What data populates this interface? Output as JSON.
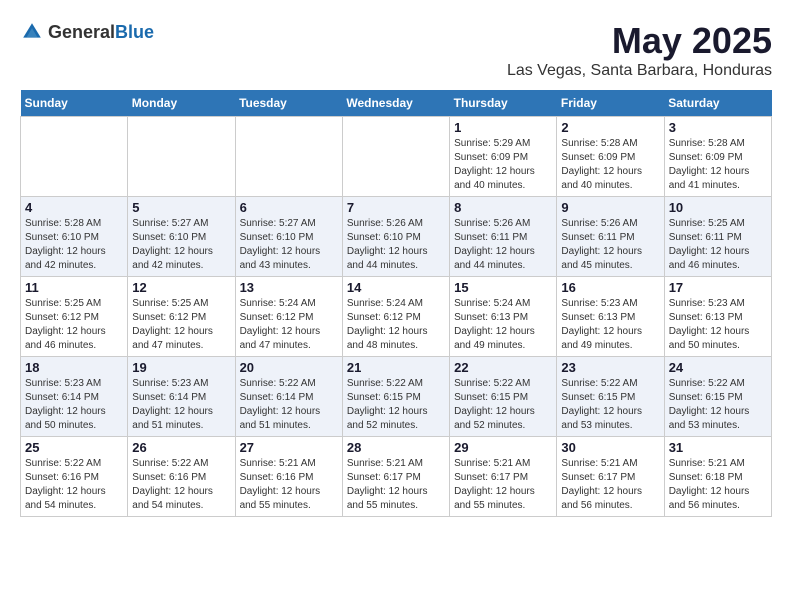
{
  "header": {
    "logo_general": "General",
    "logo_blue": "Blue",
    "title": "May 2025",
    "location": "Las Vegas, Santa Barbara, Honduras"
  },
  "days_of_week": [
    "Sunday",
    "Monday",
    "Tuesday",
    "Wednesday",
    "Thursday",
    "Friday",
    "Saturday"
  ],
  "weeks": [
    [
      {
        "day": "",
        "info": ""
      },
      {
        "day": "",
        "info": ""
      },
      {
        "day": "",
        "info": ""
      },
      {
        "day": "",
        "info": ""
      },
      {
        "day": "1",
        "info": "Sunrise: 5:29 AM\nSunset: 6:09 PM\nDaylight: 12 hours\nand 40 minutes."
      },
      {
        "day": "2",
        "info": "Sunrise: 5:28 AM\nSunset: 6:09 PM\nDaylight: 12 hours\nand 40 minutes."
      },
      {
        "day": "3",
        "info": "Sunrise: 5:28 AM\nSunset: 6:09 PM\nDaylight: 12 hours\nand 41 minutes."
      }
    ],
    [
      {
        "day": "4",
        "info": "Sunrise: 5:28 AM\nSunset: 6:10 PM\nDaylight: 12 hours\nand 42 minutes."
      },
      {
        "day": "5",
        "info": "Sunrise: 5:27 AM\nSunset: 6:10 PM\nDaylight: 12 hours\nand 42 minutes."
      },
      {
        "day": "6",
        "info": "Sunrise: 5:27 AM\nSunset: 6:10 PM\nDaylight: 12 hours\nand 43 minutes."
      },
      {
        "day": "7",
        "info": "Sunrise: 5:26 AM\nSunset: 6:10 PM\nDaylight: 12 hours\nand 44 minutes."
      },
      {
        "day": "8",
        "info": "Sunrise: 5:26 AM\nSunset: 6:11 PM\nDaylight: 12 hours\nand 44 minutes."
      },
      {
        "day": "9",
        "info": "Sunrise: 5:26 AM\nSunset: 6:11 PM\nDaylight: 12 hours\nand 45 minutes."
      },
      {
        "day": "10",
        "info": "Sunrise: 5:25 AM\nSunset: 6:11 PM\nDaylight: 12 hours\nand 46 minutes."
      }
    ],
    [
      {
        "day": "11",
        "info": "Sunrise: 5:25 AM\nSunset: 6:12 PM\nDaylight: 12 hours\nand 46 minutes."
      },
      {
        "day": "12",
        "info": "Sunrise: 5:25 AM\nSunset: 6:12 PM\nDaylight: 12 hours\nand 47 minutes."
      },
      {
        "day": "13",
        "info": "Sunrise: 5:24 AM\nSunset: 6:12 PM\nDaylight: 12 hours\nand 47 minutes."
      },
      {
        "day": "14",
        "info": "Sunrise: 5:24 AM\nSunset: 6:12 PM\nDaylight: 12 hours\nand 48 minutes."
      },
      {
        "day": "15",
        "info": "Sunrise: 5:24 AM\nSunset: 6:13 PM\nDaylight: 12 hours\nand 49 minutes."
      },
      {
        "day": "16",
        "info": "Sunrise: 5:23 AM\nSunset: 6:13 PM\nDaylight: 12 hours\nand 49 minutes."
      },
      {
        "day": "17",
        "info": "Sunrise: 5:23 AM\nSunset: 6:13 PM\nDaylight: 12 hours\nand 50 minutes."
      }
    ],
    [
      {
        "day": "18",
        "info": "Sunrise: 5:23 AM\nSunset: 6:14 PM\nDaylight: 12 hours\nand 50 minutes."
      },
      {
        "day": "19",
        "info": "Sunrise: 5:23 AM\nSunset: 6:14 PM\nDaylight: 12 hours\nand 51 minutes."
      },
      {
        "day": "20",
        "info": "Sunrise: 5:22 AM\nSunset: 6:14 PM\nDaylight: 12 hours\nand 51 minutes."
      },
      {
        "day": "21",
        "info": "Sunrise: 5:22 AM\nSunset: 6:15 PM\nDaylight: 12 hours\nand 52 minutes."
      },
      {
        "day": "22",
        "info": "Sunrise: 5:22 AM\nSunset: 6:15 PM\nDaylight: 12 hours\nand 52 minutes."
      },
      {
        "day": "23",
        "info": "Sunrise: 5:22 AM\nSunset: 6:15 PM\nDaylight: 12 hours\nand 53 minutes."
      },
      {
        "day": "24",
        "info": "Sunrise: 5:22 AM\nSunset: 6:15 PM\nDaylight: 12 hours\nand 53 minutes."
      }
    ],
    [
      {
        "day": "25",
        "info": "Sunrise: 5:22 AM\nSunset: 6:16 PM\nDaylight: 12 hours\nand 54 minutes."
      },
      {
        "day": "26",
        "info": "Sunrise: 5:22 AM\nSunset: 6:16 PM\nDaylight: 12 hours\nand 54 minutes."
      },
      {
        "day": "27",
        "info": "Sunrise: 5:21 AM\nSunset: 6:16 PM\nDaylight: 12 hours\nand 55 minutes."
      },
      {
        "day": "28",
        "info": "Sunrise: 5:21 AM\nSunset: 6:17 PM\nDaylight: 12 hours\nand 55 minutes."
      },
      {
        "day": "29",
        "info": "Sunrise: 5:21 AM\nSunset: 6:17 PM\nDaylight: 12 hours\nand 55 minutes."
      },
      {
        "day": "30",
        "info": "Sunrise: 5:21 AM\nSunset: 6:17 PM\nDaylight: 12 hours\nand 56 minutes."
      },
      {
        "day": "31",
        "info": "Sunrise: 5:21 AM\nSunset: 6:18 PM\nDaylight: 12 hours\nand 56 minutes."
      }
    ]
  ]
}
